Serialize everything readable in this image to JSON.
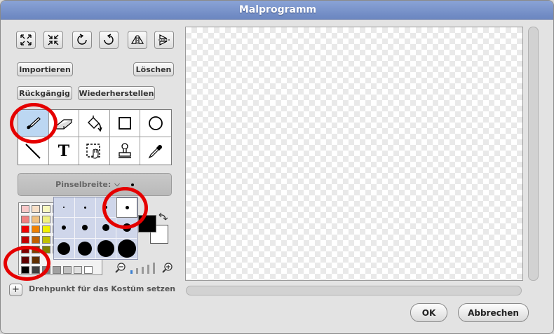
{
  "window": {
    "title": "Malprogramm"
  },
  "toolbar_icons": [
    {
      "name": "grow-icon"
    },
    {
      "name": "shrink-icon"
    },
    {
      "name": "rotate-left-icon"
    },
    {
      "name": "rotate-right-icon"
    },
    {
      "name": "flip-horizontal-icon"
    },
    {
      "name": "flip-vertical-icon"
    }
  ],
  "buttons": {
    "import": "Importieren",
    "clear": "Löschen",
    "undo": "Rückgängig",
    "redo": "Wiederherstellen",
    "ok": "OK",
    "cancel": "Abbrechen"
  },
  "tools": [
    {
      "name": "paintbrush",
      "selected": true
    },
    {
      "name": "eraser"
    },
    {
      "name": "fill"
    },
    {
      "name": "rectangle"
    },
    {
      "name": "ellipse"
    },
    {
      "name": "line"
    },
    {
      "name": "text",
      "glyph": "T"
    },
    {
      "name": "select"
    },
    {
      "name": "stamp"
    },
    {
      "name": "eyedropper"
    }
  ],
  "brush": {
    "label": "Pinselbreite:",
    "selected_size_index": 3
  },
  "colors": {
    "foreground": "#000000",
    "background": "#ffffff",
    "selection_highlight": "#bcd7f2",
    "annotation_red": "#e50000"
  },
  "palette_rows": [
    [
      "#f8c8c8",
      "#f8e0c8",
      "#f8f8c0",
      "#c8f0c8"
    ],
    [
      "#f08080",
      "#f0c080",
      "#f0f080",
      "#80e080"
    ],
    [
      "#f00000",
      "#f08000",
      "#f0f000",
      "#00c000"
    ],
    [
      "#c00000",
      "#c06000",
      "#c0c000",
      "#008000"
    ],
    [
      "#800000",
      "#804000",
      "#808000",
      "#004000"
    ],
    [
      "#600000",
      "#603000"
    ],
    [
      "#000000",
      "#404040",
      "#808080",
      "#a0a0a0",
      "#c0c0c0",
      "#e0e0e0",
      "#ffffff"
    ]
  ],
  "rotation_center": {
    "plus": "+",
    "label": "Drehpunkt für das Kostüm setzen"
  }
}
